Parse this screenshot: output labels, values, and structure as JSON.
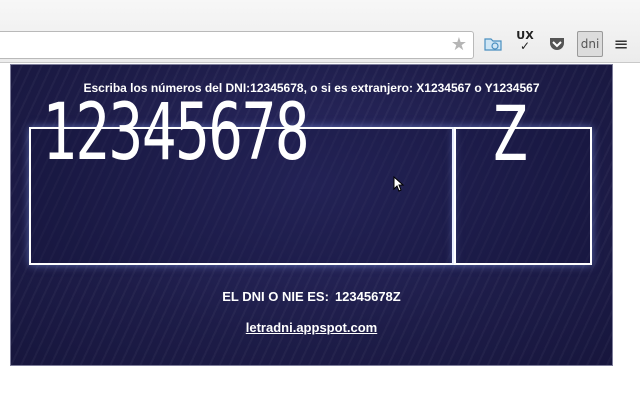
{
  "browser": {
    "star_glyph": "★",
    "ux_label": "UX",
    "ux_check": "✓",
    "dni_label": "dni",
    "menu_glyph": "≡"
  },
  "popup": {
    "instructions": "Escriba los números del DNI:12345678, o si es extranjero: X1234567 o Y1234567",
    "dni_digits": "12345678",
    "dni_letter": "Z",
    "result_label": "EL DNI O NIE ES:",
    "result_value": "12345678Z",
    "site_link": "letradni.appspot.com"
  },
  "colors": {
    "panel_bg": "#1f1f4a",
    "text": "#ffffff",
    "border": "#ffffff"
  }
}
